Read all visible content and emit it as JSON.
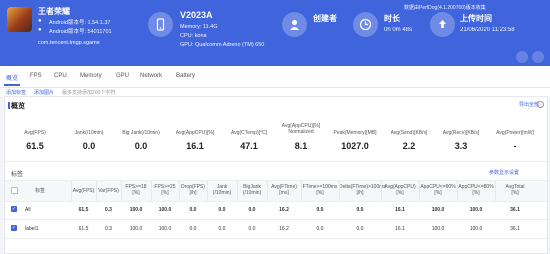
{
  "app": {
    "name": "王者荣耀",
    "android_version": "Android版本号: 1.54.1.37",
    "android_code": "Android版本号: 54011701",
    "package": "com.tencent.tmgp.sgame"
  },
  "device": {
    "name": "V2023A",
    "memory": "Memory: 11.4G",
    "cpu": "CPU: kona",
    "gpu": "GPU: Qualcomm Adreno (TM) 650"
  },
  "stats": {
    "creator_label": "创建者",
    "creator_value": "",
    "duration_label": "时长",
    "duration_value": "0h 0m 48s",
    "upload_label": "上传时间",
    "upload_value": "21/06/2020 11:23:58"
  },
  "header_note": "数据由PerfDog(4.1.200700)版本收集",
  "tabs": [
    "概览",
    "FPS",
    "CPU",
    "Memory",
    "GPU",
    "Network",
    "Battery"
  ],
  "toolbar": {
    "add_label": "添加标签",
    "image_label": "添加图片",
    "hint": "最多支持添加200个字符"
  },
  "summary": {
    "title": "概览",
    "export_label": "导出全部",
    "help": "?",
    "items": [
      {
        "label": "Avg(FPS)",
        "value": "61.5"
      },
      {
        "label": "Jank(/10min)",
        "value": "0.0"
      },
      {
        "label": "Big Jank(/10min)",
        "value": "0.0"
      },
      {
        "label": "Avg(AppCPU)[%]",
        "value": "16.1"
      },
      {
        "label": "Avg(CTemp)[°C]",
        "value": "47.1"
      },
      {
        "label": "Avg(AppCPU)[%]\nNormalized",
        "value": "8.1"
      },
      {
        "label": "Peak(Memory)[MB]",
        "value": "1027.0"
      },
      {
        "label": "Avg(Send)[KB/s]",
        "value": "2.2"
      },
      {
        "label": "Avg(Recv)[KB/s]",
        "value": "3.3"
      },
      {
        "label": "Avg(Power)[mW]",
        "value": "-"
      }
    ]
  },
  "table": {
    "title": "标签",
    "config_label": "参数显示设置",
    "headers": [
      "标签",
      "Avg(FPS)",
      "Var(FPS)",
      "FPS>=18\n[%]",
      "FPS>=25\n[%]",
      "Drop(FPS)\n[/h]",
      "Jank\n(/10min)",
      "BigJank\n(/10min)",
      "Avg(FTime)\n[ms]",
      "FTime>=100ms\n[%]",
      "Delta(FTime)>100ms\n[/h]",
      "Avg(AppCPU)\n[%]",
      "AppCPU<=60%\n[%]",
      "AppCPU<=80%\n[%]",
      "AvgTotal\n[%]"
    ],
    "rows": [
      {
        "name": "All",
        "cells": [
          "61.5",
          "0.3",
          "100.0",
          "100.0",
          "0.0",
          "0.0",
          "0.0",
          "16.2",
          "0.0",
          "0.0",
          "16.1",
          "100.0",
          "100.0",
          "36.1"
        ]
      },
      {
        "name": "label1",
        "cells": [
          "61.5",
          "0.3",
          "100.0",
          "100.0",
          "0.0",
          "0.0",
          "0.0",
          "16.2",
          "0.0",
          "0.0",
          "16.1",
          "100.0",
          "100.0",
          "36.1"
        ]
      }
    ]
  },
  "colors": {
    "header_bg": "#3f64dc",
    "accent": "#3f64dc"
  }
}
